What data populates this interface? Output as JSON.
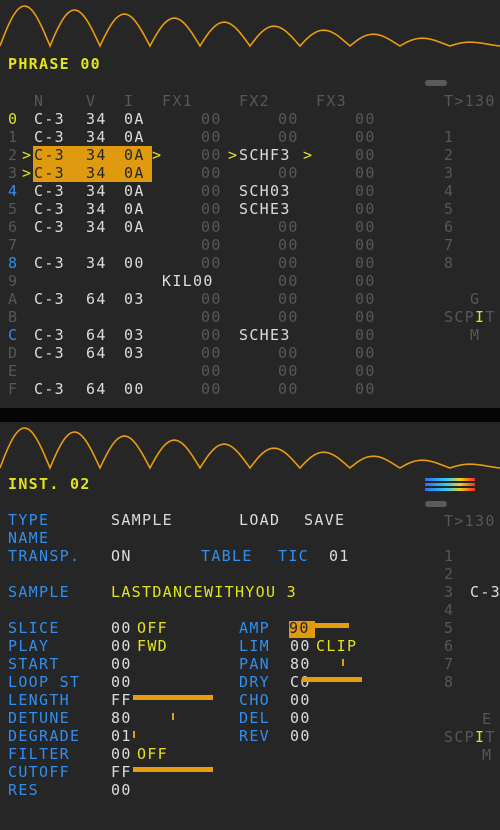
{
  "phrase": {
    "title": "PHRASE 00",
    "headers": [
      "N",
      "V",
      "I",
      "FX1",
      "FX2",
      "FX3",
      "T>130"
    ],
    "rows": [
      {
        "idx": "0",
        "note": "C-3",
        "vol": "34",
        "ins": "0A",
        "fx1": "",
        "v1": "00",
        "fx2": "",
        "v2": "00",
        "fx3": "",
        "v3": "00",
        "side": ""
      },
      {
        "idx": "1",
        "note": "C-3",
        "vol": "34",
        "ins": "0A",
        "fx1": "",
        "v1": "00",
        "fx2": "",
        "v2": "00",
        "fx3": "",
        "v3": "00",
        "side": "1"
      },
      {
        "idx": "2",
        "note": "C-3",
        "vol": "34",
        "ins": "0A",
        "fx1": "",
        "v1": "00",
        "fx2": "SCHF3",
        "v2": "",
        "fx3": "",
        "v3": "00",
        "side": "2"
      },
      {
        "idx": "3",
        "note": "C-3",
        "vol": "34",
        "ins": "0A",
        "fx1": "",
        "v1": "00",
        "fx2": "",
        "v2": "00",
        "fx3": "",
        "v3": "00",
        "side": "3"
      },
      {
        "idx": "4",
        "note": "C-3",
        "vol": "34",
        "ins": "0A",
        "fx1": "",
        "v1": "00",
        "fx2": "SCH03",
        "v2": "",
        "fx3": "",
        "v3": "00",
        "side": "4"
      },
      {
        "idx": "5",
        "note": "C-3",
        "vol": "34",
        "ins": "0A",
        "fx1": "",
        "v1": "00",
        "fx2": "SCHE3",
        "v2": "",
        "fx3": "",
        "v3": "00",
        "side": "5"
      },
      {
        "idx": "6",
        "note": "C-3",
        "vol": "34",
        "ins": "0A",
        "fx1": "",
        "v1": "00",
        "fx2": "",
        "v2": "00",
        "fx3": "",
        "v3": "00",
        "side": "6"
      },
      {
        "idx": "7",
        "note": "",
        "vol": "",
        "ins": "",
        "fx1": "",
        "v1": "00",
        "fx2": "",
        "v2": "00",
        "fx3": "",
        "v3": "00",
        "side": "7"
      },
      {
        "idx": "8",
        "note": "C-3",
        "vol": "34",
        "ins": "00",
        "fx1": "",
        "v1": "00",
        "fx2": "",
        "v2": "00",
        "fx3": "",
        "v3": "00",
        "side": "8"
      },
      {
        "idx": "9",
        "note": "",
        "vol": "",
        "ins": "",
        "fx1": "KIL00",
        "v1": "",
        "fx2": "",
        "v2": "00",
        "fx3": "",
        "v3": "00",
        "side": ""
      },
      {
        "idx": "A",
        "note": "C-3",
        "vol": "64",
        "ins": "03",
        "fx1": "",
        "v1": "00",
        "fx2": "",
        "v2": "00",
        "fx3": "",
        "v3": "00",
        "side": "G"
      },
      {
        "idx": "B",
        "note": "",
        "vol": "",
        "ins": "",
        "fx1": "",
        "v1": "00",
        "fx2": "",
        "v2": "00",
        "fx3": "",
        "v3": "00",
        "side": "SCPIT"
      },
      {
        "idx": "C",
        "note": "C-3",
        "vol": "64",
        "ins": "03",
        "fx1": "",
        "v1": "00",
        "fx2": "SCHE3",
        "v2": "",
        "fx3": "",
        "v3": "00",
        "side": "M"
      },
      {
        "idx": "D",
        "note": "C-3",
        "vol": "64",
        "ins": "03",
        "fx1": "",
        "v1": "00",
        "fx2": "",
        "v2": "00",
        "fx3": "",
        "v3": "00",
        "side": ""
      },
      {
        "idx": "E",
        "note": "",
        "vol": "",
        "ins": "",
        "fx1": "",
        "v1": "00",
        "fx2": "",
        "v2": "00",
        "fx3": "",
        "v3": "00",
        "side": ""
      },
      {
        "idx": "F",
        "note": "C-3",
        "vol": "64",
        "ins": "00",
        "fx1": "",
        "v1": "00",
        "fx2": "",
        "v2": "00",
        "fx3": "",
        "v3": "00",
        "side": ""
      }
    ],
    "selection_markers": {
      "row2_left": ">",
      "row2_right": ">",
      "row3_left": ">",
      "fx2_left": ">",
      "fx2_right": ">"
    }
  },
  "instrument": {
    "title": "INST. 02",
    "type_label": "TYPE",
    "type_value": "SAMPLE",
    "load_label": "LOAD",
    "save_label": "SAVE",
    "name_label": "NAME",
    "transp_label": "TRANSP.",
    "transp_value": "ON",
    "table_label": "TABLE",
    "tic_label": "TIC",
    "tic_value": "01",
    "sample_label": "SAMPLE",
    "sample_value": "LASTDANCEWITHYOU 3",
    "left_params": [
      {
        "label": "SLICE",
        "value": "00",
        "extra": "OFF"
      },
      {
        "label": "PLAY",
        "value": "00",
        "extra": "FWD"
      },
      {
        "label": "START",
        "value": "00",
        "extra": ""
      },
      {
        "label": "LOOP ST",
        "value": "00",
        "extra": ""
      },
      {
        "label": "LENGTH",
        "value": "FF",
        "extra": ""
      },
      {
        "label": "DETUNE",
        "value": "80",
        "extra": ""
      },
      {
        "label": "DEGRADE",
        "value": "01",
        "extra": ""
      },
      {
        "label": "FILTER",
        "value": "00",
        "extra": "OFF"
      },
      {
        "label": "CUTOFF",
        "value": "FF",
        "extra": ""
      },
      {
        "label": "RES",
        "value": "00",
        "extra": ""
      }
    ],
    "right_params": [
      {
        "label": "AMP",
        "value": "90",
        "extra": ""
      },
      {
        "label": "LIM",
        "value": "00",
        "extra": "CLIP"
      },
      {
        "label": "PAN",
        "value": "80",
        "extra": ""
      },
      {
        "label": "DRY",
        "value": "C0",
        "extra": ""
      },
      {
        "label": "CHO",
        "value": "00",
        "extra": ""
      },
      {
        "label": "DEL",
        "value": "00",
        "extra": ""
      },
      {
        "label": "REV",
        "value": "00",
        "extra": ""
      }
    ],
    "levels": {
      "length": 1.0,
      "detune": 0.5,
      "degrade": 0.004,
      "cutoff": 1.0,
      "amp": 0.56,
      "pan": 0.5,
      "dry": 0.75
    },
    "side_header": "T>130",
    "side_rows": [
      "1",
      "2",
      "3",
      "4",
      "5",
      "6",
      "7",
      "8"
    ],
    "side_row3_extra": "C-3",
    "side_bottom": [
      "E",
      "SCPIT",
      "M"
    ],
    "colors": {
      "accent": "#e89c10",
      "header": "#e2e21e",
      "label": "#2f8ff0",
      "value": "#dcdcdc",
      "dim": "#575757"
    }
  }
}
